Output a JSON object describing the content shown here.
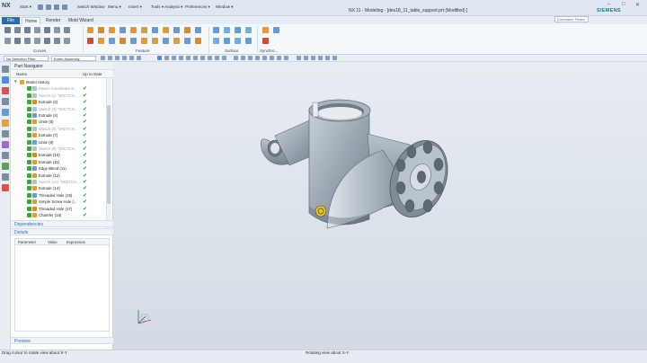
{
  "titlebar": {
    "logo": "NX",
    "start": "Start",
    "switch_window": "Switch Window",
    "menu": "Menu",
    "insert": "Insert",
    "tools": "Tools",
    "analysis": "Analysis",
    "preferences": "Preferences",
    "window": "Window",
    "title": "NX 11 - Modeling - [des18_11_table_support.prt (Modified) ]",
    "brand": "SIEMENS",
    "minimize": "–",
    "maximize": "□",
    "close": "✕"
  },
  "tabs": [
    "File",
    "Home",
    "Render",
    "Mold Wizard"
  ],
  "command_search_placeholder": "Command Finder",
  "ribbon_groups": {
    "curves": "Curves",
    "feature": "Feature",
    "surface": "Surface",
    "synchronous": "Synchro..."
  },
  "selection_bar": {
    "filter": "No Selection Filter",
    "scope": "Entire Assembly"
  },
  "part_navigator": {
    "title": "Part Navigator",
    "col_name": "Name",
    "col_uptodate": "Up to Date",
    "nodes": [
      {
        "label": "Model History",
        "gray": false,
        "indent": 0
      },
      {
        "label": "Datum Coordinate S...",
        "gray": true
      },
      {
        "label": "Sketch (1) \"SKETCH...",
        "gray": true
      },
      {
        "label": "Extrude (2)",
        "gray": false
      },
      {
        "label": "Sketch (3) \"SKETCH...",
        "gray": true
      },
      {
        "label": "Extrude (4)",
        "gray": false
      },
      {
        "label": "Unite (5)",
        "gray": false
      },
      {
        "label": "Sketch (6) \"SKETCH...",
        "gray": true
      },
      {
        "label": "Extrude (7)",
        "gray": false
      },
      {
        "label": "Unite (8)",
        "gray": false
      },
      {
        "label": "Sketch (9) \"SKETCH...",
        "gray": true
      },
      {
        "label": "Extrude (10)",
        "gray": false
      },
      {
        "label": "Extrude (11)",
        "gray": false
      },
      {
        "label": "Edge Blend (11)",
        "gray": false
      },
      {
        "label": "Extrude (12)",
        "gray": false
      },
      {
        "label": "Sketch (13) \"SKETCH...",
        "gray": true
      },
      {
        "label": "Extrude (14)",
        "gray": false
      },
      {
        "label": "Threaded Hole (15)",
        "gray": false
      },
      {
        "label": "Simple Screw Hole (...",
        "gray": false
      },
      {
        "label": "Threaded Hole (17)",
        "gray": false
      },
      {
        "label": "Chamfer (18)",
        "gray": false
      }
    ],
    "dependencies": "Dependencies",
    "details": "Details",
    "details_cols": [
      "Parameter",
      "Value",
      "Expression"
    ],
    "preview": "Preview"
  },
  "status": {
    "left": "Drag cursor to rotate view about X-Y",
    "middle": "Rotating view about X-Y"
  },
  "colors": {
    "accent": "#2f6aa6",
    "ok_green": "#2e9a2e",
    "part_gray": "#8d99a4"
  }
}
